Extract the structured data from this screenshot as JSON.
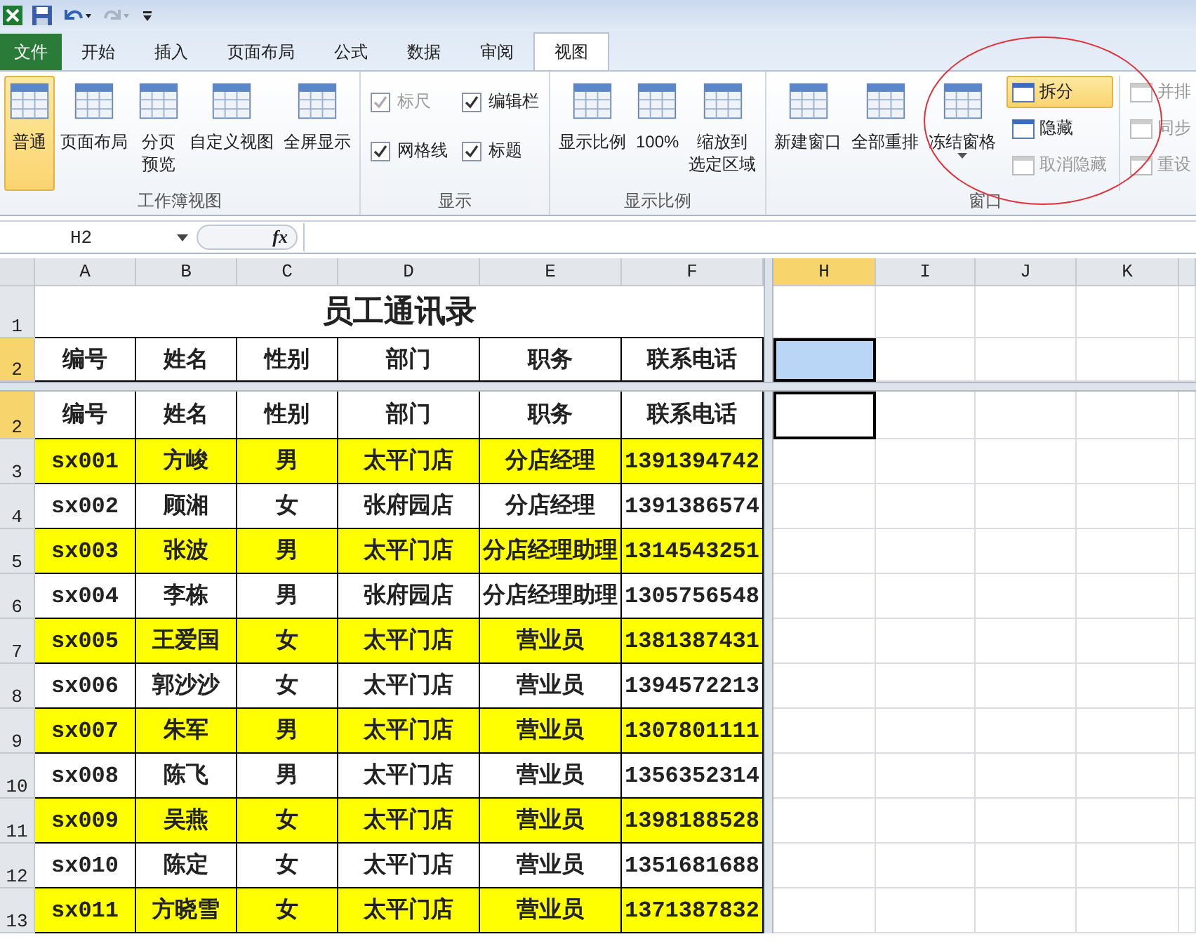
{
  "tabs": [
    {
      "label": "文件",
      "kind": "file",
      "selected": false
    },
    {
      "label": "开始",
      "kind": "tab",
      "selected": false
    },
    {
      "label": "插入",
      "kind": "tab",
      "selected": false
    },
    {
      "label": "页面布局",
      "kind": "tab",
      "selected": false
    },
    {
      "label": "公式",
      "kind": "tab",
      "selected": false
    },
    {
      "label": "数据",
      "kind": "tab",
      "selected": false
    },
    {
      "label": "审阅",
      "kind": "tab",
      "selected": false
    },
    {
      "label": "视图",
      "kind": "tab",
      "selected": true
    }
  ],
  "ribbon_groups": [
    {
      "label": "工作簿视图",
      "items": [
        {
          "kind": "large",
          "lines": [
            "普通"
          ],
          "selected": true
        },
        {
          "kind": "large",
          "lines": [
            "页面布局"
          ],
          "selected": false
        },
        {
          "kind": "large",
          "lines": [
            "分页",
            "预览"
          ],
          "selected": false
        },
        {
          "kind": "large",
          "lines": [
            "自定义视图"
          ],
          "selected": false
        },
        {
          "kind": "large",
          "lines": [
            "全屏显示"
          ],
          "selected": false
        }
      ]
    },
    {
      "label": "显示",
      "items": [
        {
          "kind": "checkbox",
          "label": "标尺",
          "checked": true,
          "disabled": true
        },
        {
          "kind": "checkbox",
          "label": "编辑栏",
          "checked": true,
          "disabled": false
        },
        {
          "kind": "checkbox",
          "label": "网格线",
          "checked": true,
          "disabled": false
        },
        {
          "kind": "checkbox",
          "label": "标题",
          "checked": true,
          "disabled": false
        }
      ]
    },
    {
      "label": "显示比例",
      "items": [
        {
          "kind": "large",
          "lines": [
            "显示比例"
          ],
          "selected": false
        },
        {
          "kind": "large",
          "lines": [
            "100%"
          ],
          "selected": false
        },
        {
          "kind": "large",
          "lines": [
            "缩放到",
            "选定区域"
          ],
          "selected": false
        }
      ]
    },
    {
      "label": "窗口",
      "items": [
        {
          "kind": "large",
          "lines": [
            "新建窗口"
          ],
          "selected": false
        },
        {
          "kind": "large",
          "lines": [
            "全部重排"
          ],
          "selected": false
        },
        {
          "kind": "dropdown",
          "lines": [
            "冻结窗格"
          ],
          "selected": false
        },
        {
          "kind": "small",
          "label": "拆分",
          "selected": true,
          "disabled": false
        },
        {
          "kind": "small",
          "label": "隐藏",
          "selected": false,
          "disabled": false
        },
        {
          "kind": "small",
          "label": "取消隐藏",
          "selected": false,
          "disabled": true
        },
        {
          "kind": "small",
          "label": "并排",
          "selected": false,
          "disabled": true
        },
        {
          "kind": "small",
          "label": "同步",
          "selected": false,
          "disabled": true
        },
        {
          "kind": "small",
          "label": "重设",
          "selected": false,
          "disabled": true
        }
      ]
    }
  ],
  "name_box": "H2",
  "formula_button": "fx",
  "columns": [
    {
      "label": "A",
      "selected": false
    },
    {
      "label": "B",
      "selected": false
    },
    {
      "label": "C",
      "selected": false
    },
    {
      "label": "D",
      "selected": false
    },
    {
      "label": "E",
      "selected": false
    },
    {
      "label": "F",
      "selected": false
    },
    {
      "label": "H",
      "selected": true
    },
    {
      "label": "I",
      "selected": false
    },
    {
      "label": "J",
      "selected": false
    },
    {
      "label": "K",
      "selected": false
    }
  ],
  "title_row": {
    "row_label": "1",
    "title": "员工通讯录"
  },
  "frozen_row": {
    "row_label": "2",
    "active": true,
    "cells": [
      "编号",
      "姓名",
      "性别",
      "部门",
      "职务",
      "联系电话"
    ]
  },
  "rows": [
    {
      "row_label": "2",
      "highlighted": false,
      "active": true,
      "cells": [
        "编号",
        "姓名",
        "性别",
        "部门",
        "职务",
        "联系电话"
      ]
    },
    {
      "row_label": "3",
      "highlighted": true,
      "active": false,
      "cells": [
        "sx001",
        "方峻",
        "男",
        "太平门店",
        "分店经理",
        "1391394742"
      ]
    },
    {
      "row_label": "4",
      "highlighted": false,
      "active": false,
      "cells": [
        "sx002",
        "顾湘",
        "女",
        "张府园店",
        "分店经理",
        "1391386574"
      ]
    },
    {
      "row_label": "5",
      "highlighted": true,
      "active": false,
      "cells": [
        "sx003",
        "张波",
        "男",
        "太平门店",
        "分店经理助理",
        "1314543251"
      ]
    },
    {
      "row_label": "6",
      "highlighted": false,
      "active": false,
      "cells": [
        "sx004",
        "李栋",
        "男",
        "张府园店",
        "分店经理助理",
        "1305756548"
      ]
    },
    {
      "row_label": "7",
      "highlighted": true,
      "active": false,
      "cells": [
        "sx005",
        "王爱国",
        "女",
        "太平门店",
        "营业员",
        "1381387431"
      ]
    },
    {
      "row_label": "8",
      "highlighted": false,
      "active": false,
      "cells": [
        "sx006",
        "郭沙沙",
        "女",
        "太平门店",
        "营业员",
        "1394572213"
      ]
    },
    {
      "row_label": "9",
      "highlighted": true,
      "active": false,
      "cells": [
        "sx007",
        "朱军",
        "男",
        "太平门店",
        "营业员",
        "1307801111"
      ]
    },
    {
      "row_label": "10",
      "highlighted": false,
      "active": false,
      "cells": [
        "sx008",
        "陈飞",
        "男",
        "太平门店",
        "营业员",
        "1356352314"
      ]
    },
    {
      "row_label": "11",
      "highlighted": true,
      "active": false,
      "cells": [
        "sx009",
        "吴燕",
        "女",
        "太平门店",
        "营业员",
        "1398188528"
      ]
    },
    {
      "row_label": "12",
      "highlighted": false,
      "active": false,
      "cells": [
        "sx010",
        "陈定",
        "女",
        "太平门店",
        "营业员",
        "1351681688"
      ]
    },
    {
      "row_label": "13",
      "highlighted": true,
      "active": false,
      "cells": [
        "sx011",
        "方晓雪",
        "女",
        "太平门店",
        "营业员",
        "1371387832"
      ]
    }
  ]
}
